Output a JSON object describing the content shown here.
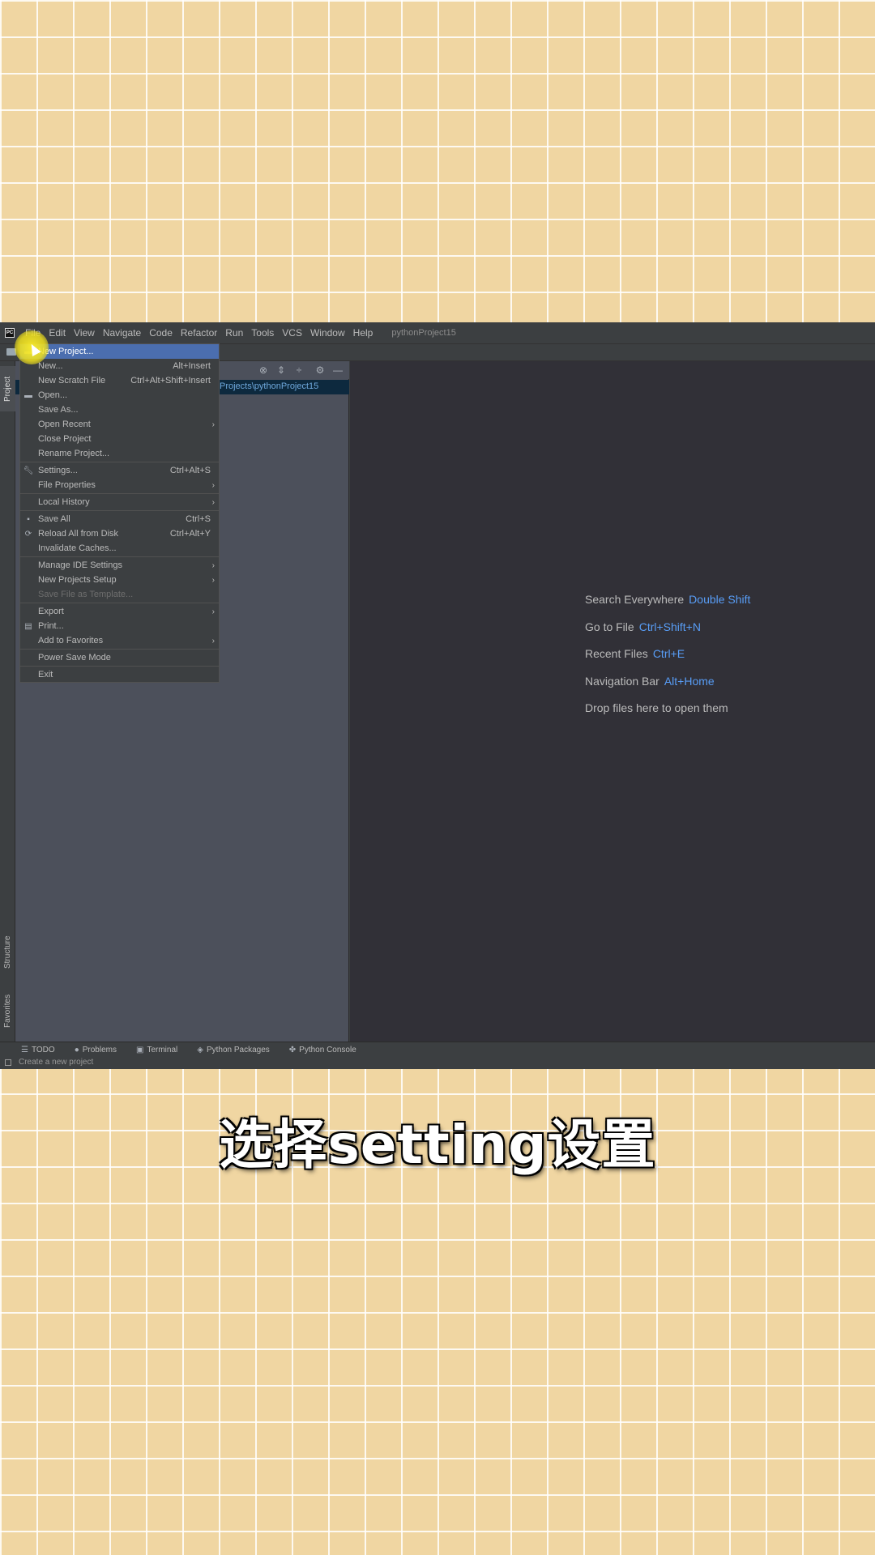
{
  "menubar": {
    "items": [
      "File",
      "Edit",
      "View",
      "Navigate",
      "Code",
      "Refactor",
      "Run",
      "Tools",
      "VCS",
      "Window",
      "Help"
    ],
    "project_title": "pythonProject15"
  },
  "project_panel": {
    "tab_label": "Project",
    "path": "Projects\\pythonProject15"
  },
  "side_tabs": {
    "structure": "Structure",
    "favorites": "Favorites"
  },
  "file_menu": {
    "items": [
      {
        "label": "New Project...",
        "shortcut": "",
        "selected": true
      },
      {
        "label": "New...",
        "shortcut": "Alt+Insert"
      },
      {
        "label": "New Scratch File",
        "shortcut": "Ctrl+Alt+Shift+Insert"
      },
      {
        "label": "Open...",
        "shortcut": ""
      },
      {
        "label": "Save As...",
        "shortcut": ""
      },
      {
        "label": "Open Recent",
        "shortcut": ""
      },
      {
        "label": "Close Project",
        "shortcut": ""
      },
      {
        "label": "Rename Project...",
        "shortcut": ""
      },
      {
        "label": "Settings...",
        "shortcut": "Ctrl+Alt+S"
      },
      {
        "label": "File Properties",
        "shortcut": ""
      },
      {
        "label": "Local History",
        "shortcut": ""
      },
      {
        "label": "Save All",
        "shortcut": "Ctrl+S"
      },
      {
        "label": "Reload All from Disk",
        "shortcut": "Ctrl+Alt+Y"
      },
      {
        "label": "Invalidate Caches...",
        "shortcut": ""
      },
      {
        "label": "Manage IDE Settings",
        "shortcut": ""
      },
      {
        "label": "New Projects Setup",
        "shortcut": ""
      },
      {
        "label": "Save File as Template...",
        "shortcut": "",
        "disabled": true
      },
      {
        "label": "Export",
        "shortcut": ""
      },
      {
        "label": "Print...",
        "shortcut": ""
      },
      {
        "label": "Add to Favorites",
        "shortcut": ""
      },
      {
        "label": "Power Save Mode",
        "shortcut": ""
      },
      {
        "label": "Exit",
        "shortcut": ""
      }
    ]
  },
  "editor_hints": [
    {
      "label": "Search Everywhere",
      "key": "Double Shift"
    },
    {
      "label": "Go to File",
      "key": "Ctrl+Shift+N"
    },
    {
      "label": "Recent Files",
      "key": "Ctrl+E"
    },
    {
      "label": "Navigation Bar",
      "key": "Alt+Home"
    },
    {
      "label": "Drop files here to open them",
      "key": ""
    }
  ],
  "bottom_tabs": [
    "TODO",
    "Problems",
    "Terminal",
    "Python Packages",
    "Python Console"
  ],
  "status_text": "Create a new project",
  "caption": "选择setting设置",
  "colors": {
    "background": "#f0d6a2",
    "ide_bg": "#3c3f41",
    "editor_bg": "#313037",
    "selection": "#4b6eaf",
    "key_hint": "#589df6"
  }
}
